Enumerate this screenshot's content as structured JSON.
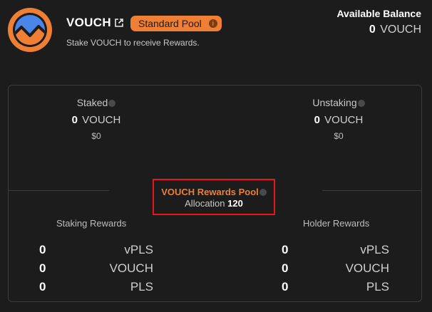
{
  "header": {
    "token_name": "VOUCH",
    "pool_badge": "Standard Pool",
    "pool_badge_info": "i",
    "subtitle": "Stake VOUCH to receive Rewards.",
    "balance_label": "Available Balance",
    "balance_amount": "0",
    "balance_unit": "VOUCH"
  },
  "stats": {
    "staked": {
      "label": "Staked",
      "amount": "0",
      "unit": "VOUCH",
      "usd": "$0"
    },
    "unstaking": {
      "label": "Unstaking",
      "amount": "0",
      "unit": "VOUCH",
      "usd": "$0"
    }
  },
  "rewards_pool": {
    "title": "VOUCH Rewards Pool",
    "allocation_label": "Allocation",
    "allocation_value": "120"
  },
  "staking_rewards": {
    "title": "Staking Rewards",
    "rows": [
      {
        "amount": "0",
        "token": "vPLS"
      },
      {
        "amount": "0",
        "token": "VOUCH"
      },
      {
        "amount": "0",
        "token": "PLS"
      }
    ]
  },
  "holder_rewards": {
    "title": "Holder Rewards",
    "rows": [
      {
        "amount": "0",
        "token": "vPLS"
      },
      {
        "amount": "0",
        "token": "VOUCH"
      },
      {
        "amount": "0",
        "token": "PLS"
      }
    ]
  },
  "colors": {
    "accent": "#ee7f35",
    "logo_blue": "#4a86e8",
    "highlight_border": "#e8161b",
    "background": "#1c1c1c"
  },
  "icons": {
    "logo": "vouch-logo-icon",
    "external_link": "external-link-icon",
    "info": "info-icon"
  }
}
